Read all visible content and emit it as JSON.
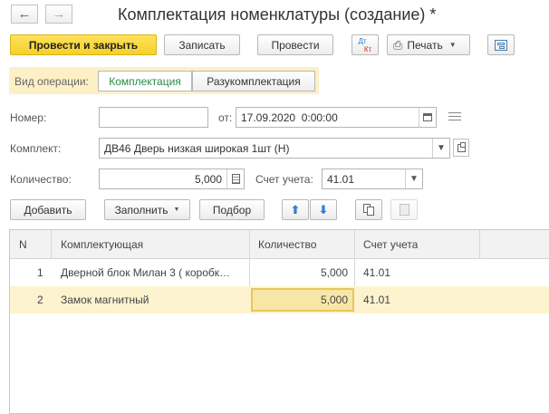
{
  "window": {
    "title": "Комплектация номенклатуры (создание) *"
  },
  "toolbar": {
    "post_close_label": "Провести и закрыть",
    "save_label": "Записать",
    "post_label": "Провести",
    "dtkt_top": "Дт",
    "dtkt_bottom": "Кт",
    "print_label": "Печать"
  },
  "operation": {
    "label": "Вид операции:",
    "options": [
      "Комплектация",
      "Разукомплектация"
    ],
    "selected": "Комплектация"
  },
  "form": {
    "number_label": "Номер:",
    "number_value": "",
    "date_label": "от:",
    "date_value": "17.09.2020  0:00:00",
    "kit_label": "Комплект:",
    "kit_value": "ДВ46 Дверь низкая широкая 1шт (Н)",
    "qty_label": "Количество:",
    "qty_value": "5,000",
    "account_label": "Счет учета:",
    "account_value": "41.01"
  },
  "table_toolbar": {
    "add_label": "Добавить",
    "fill_label": "Заполнить",
    "select_label": "Подбор"
  },
  "table": {
    "columns": [
      "N",
      "Комплектующая",
      "Количество",
      "Счет учета"
    ],
    "rows": [
      {
        "n": "1",
        "item": "Дверной блок Милан 3 ( коробк…",
        "qty": "5,000",
        "account": "41.01"
      },
      {
        "n": "2",
        "item": "Замок магнитный",
        "qty": "5,000",
        "account": "41.01"
      }
    ]
  },
  "colors": {
    "primary_button": "#f5cf2a",
    "operation_bar": "#fdf0c6",
    "selected_row": "#fdf3cf",
    "active_segment_text": "#2a8a46"
  }
}
